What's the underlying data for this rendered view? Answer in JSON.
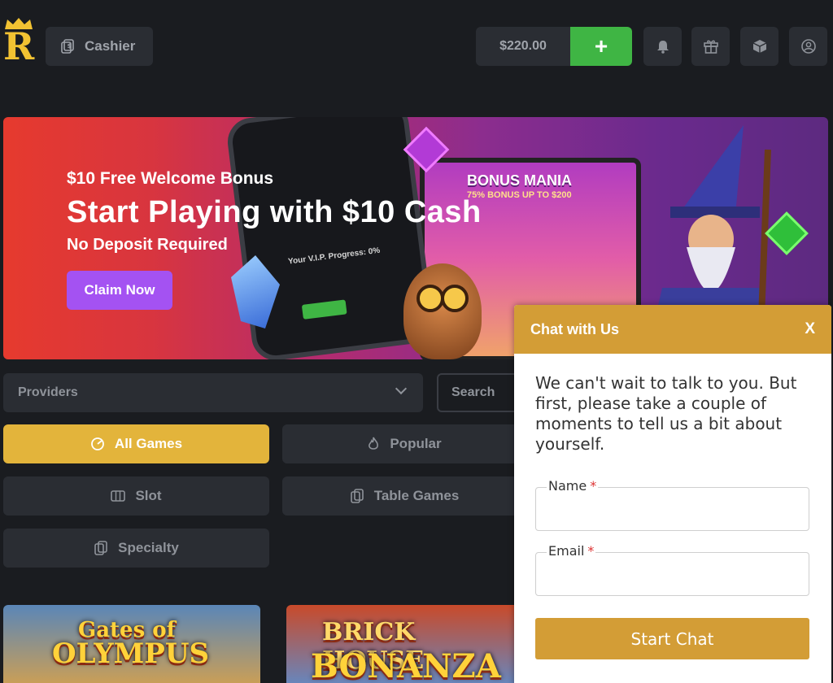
{
  "header": {
    "logo_letter": "R",
    "cashier_label": "Cashier",
    "balance": "$220.00",
    "deposit_plus": "+",
    "icons": [
      "bell-icon",
      "gift-icon",
      "cube-icon",
      "user-icon"
    ]
  },
  "banner": {
    "subtitle": "$10 Free Welcome Bonus",
    "title": "Start Playing with $10 Cash",
    "subtitle2": "No Deposit Required",
    "cta_label": "Claim Now",
    "phone_text": "Your V.I.P. Progress: 0%",
    "bonus_title": "BONUS MANIA",
    "bonus_sub": "75% BONUS UP TO $200"
  },
  "filters": {
    "providers_label": "Providers",
    "search_label": "Search"
  },
  "categories": [
    {
      "label": "All Games",
      "icon": "chip-icon",
      "active": true
    },
    {
      "label": "Popular",
      "icon": "flame-icon",
      "active": false
    },
    {
      "label": "Slot",
      "icon": "slot-icon",
      "active": false
    },
    {
      "label": "Table Games",
      "icon": "cards-icon",
      "active": false
    },
    {
      "label": "Specialty",
      "icon": "cards-icon",
      "active": false
    }
  ],
  "games": [
    {
      "line1": "Gates of",
      "line2": "OLYMPUS"
    },
    {
      "line1": "BRICK HOUSE",
      "line2": "BONANZA"
    }
  ],
  "chat": {
    "title": "Chat with Us",
    "close": "X",
    "message": "We can't wait to talk to you. But first, please take a couple of moments to tell us a bit about yourself.",
    "name_label": "Name",
    "email_label": "Email",
    "required_mark": "*",
    "start_label": "Start Chat"
  },
  "colors": {
    "accent_gold": "#e3b43b",
    "deposit_green": "#3fb544",
    "claim_purple": "#a452f2",
    "chat_header": "#d39d36"
  }
}
